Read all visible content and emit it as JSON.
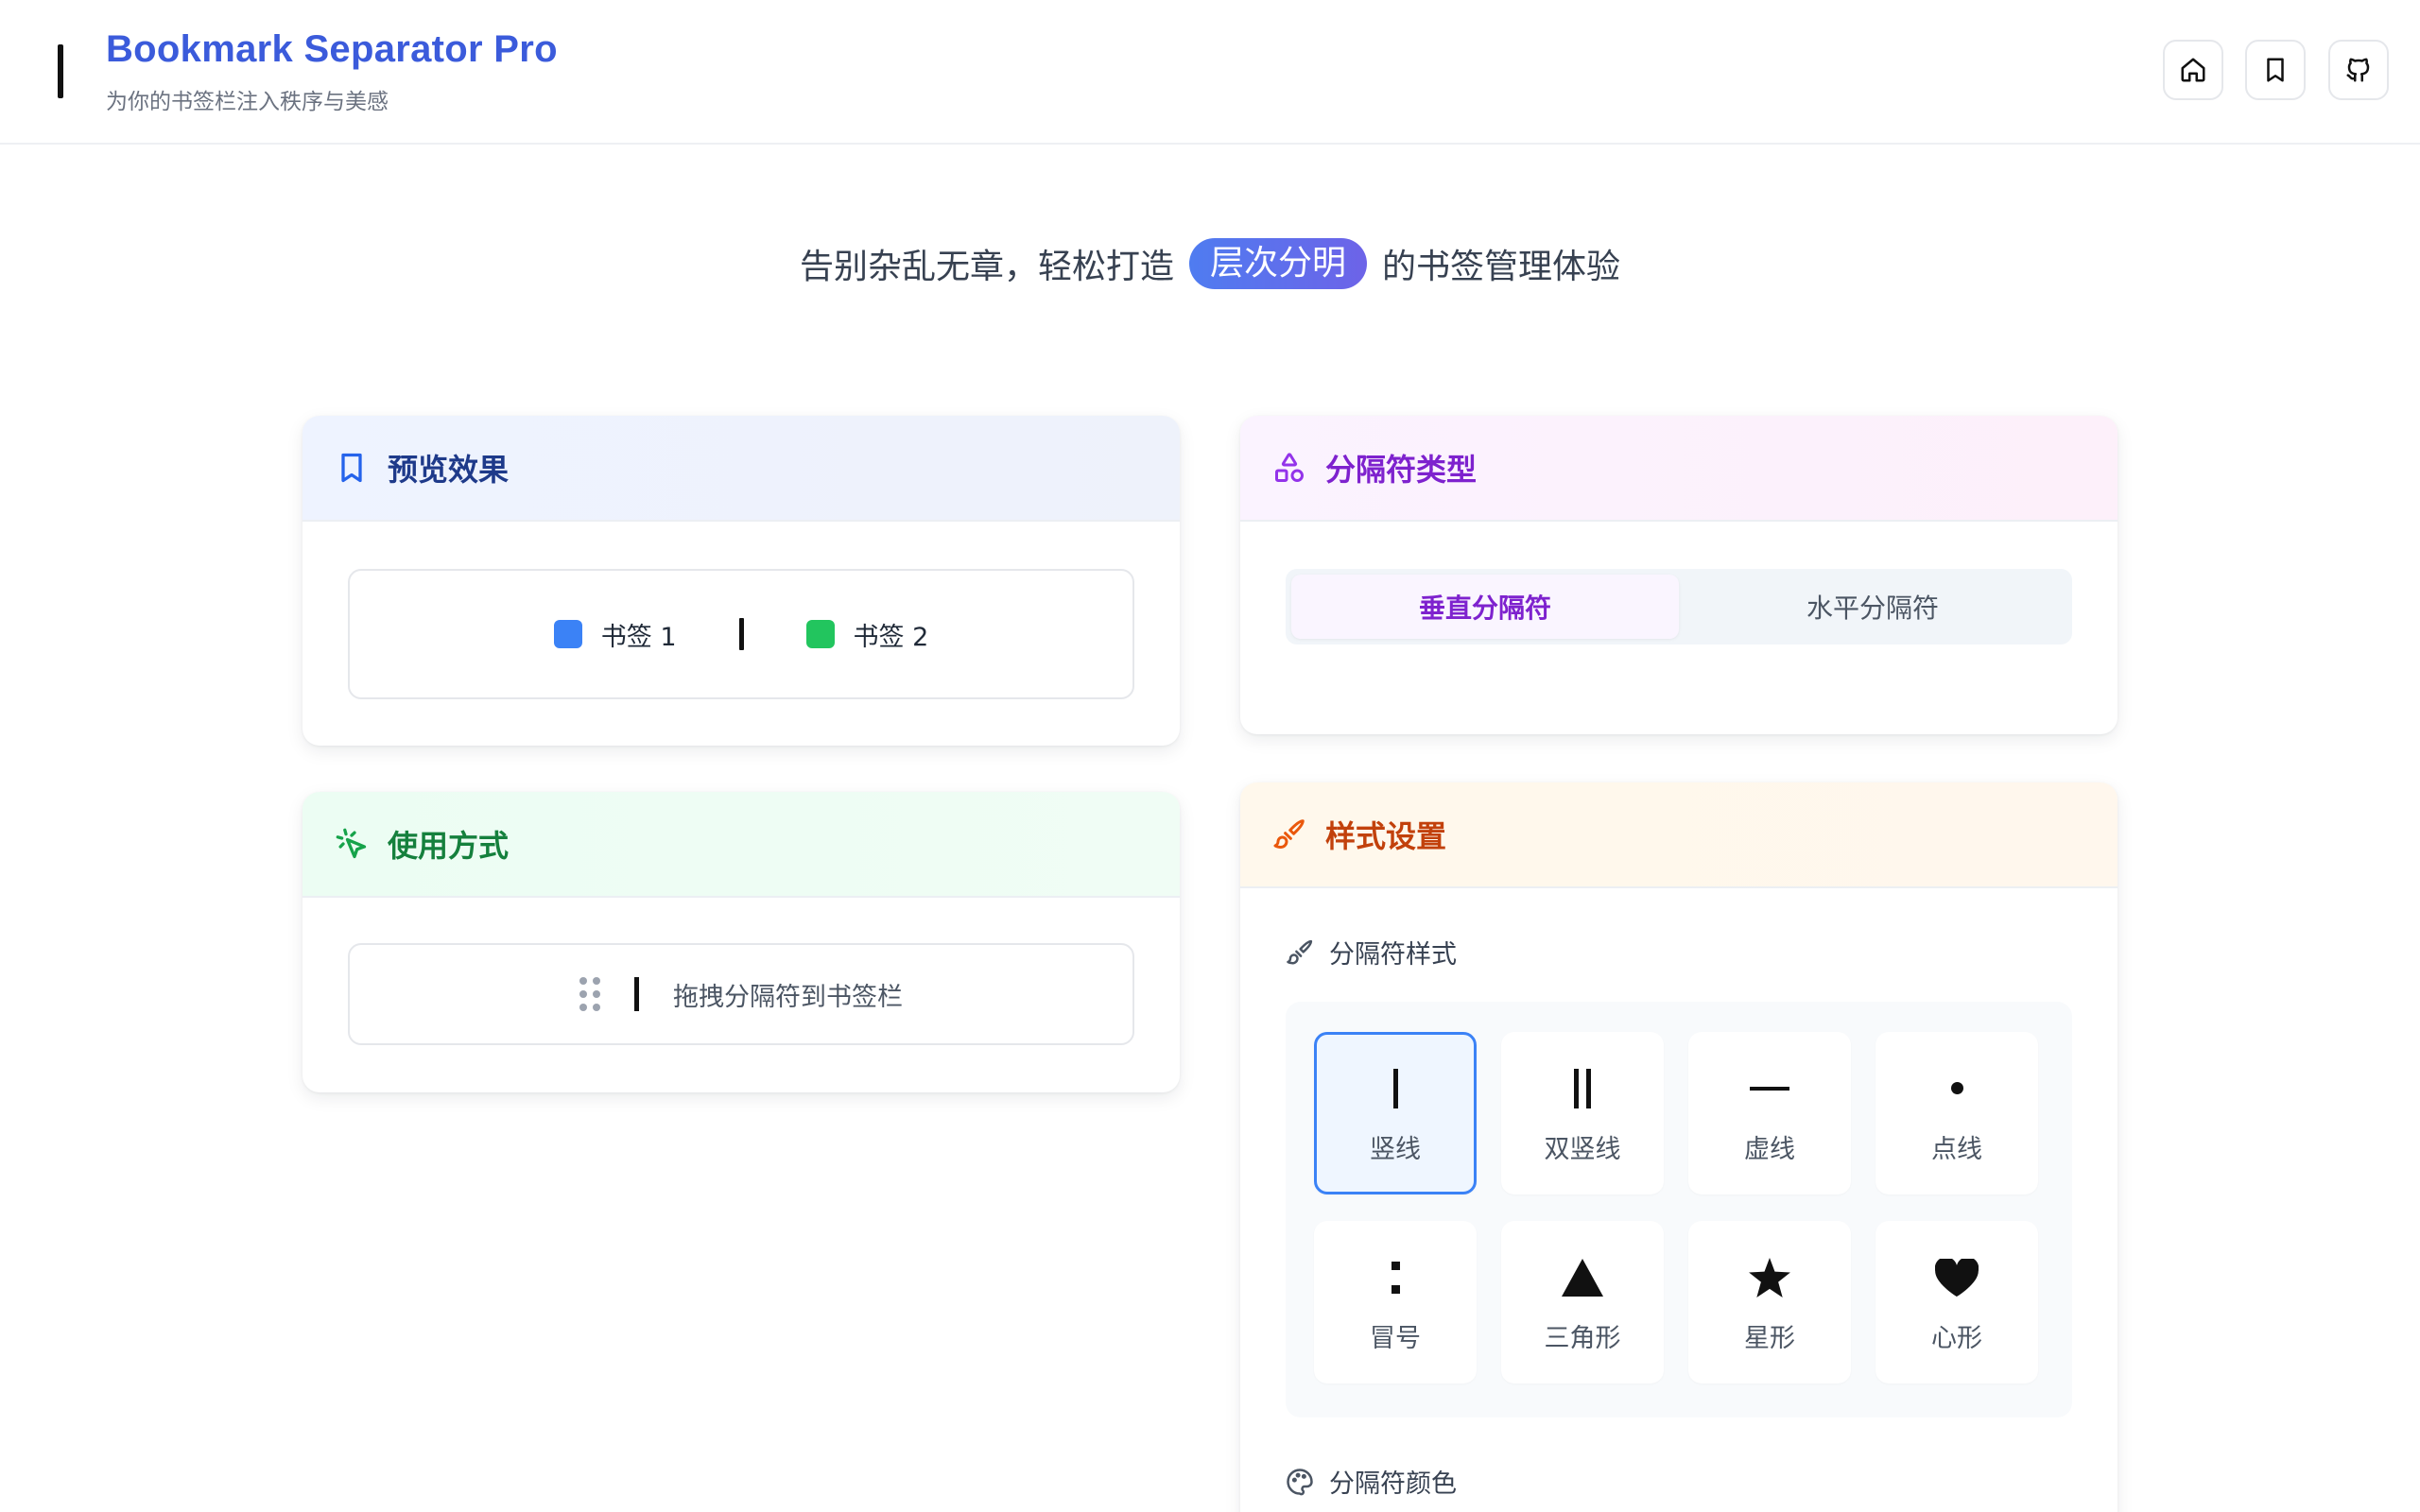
{
  "header": {
    "title": "Bookmark Separator Pro",
    "subtitle": "为你的书签栏注入秩序与美感"
  },
  "tagline": {
    "before": "告别杂乱无章，轻松打造",
    "highlight": "层次分明",
    "after": "的书签管理体验"
  },
  "preview": {
    "title": "预览效果",
    "bookmarks": [
      {
        "label": "书签 1",
        "color": "#3b82f6"
      },
      {
        "label": "书签 2",
        "color": "#22c55e"
      }
    ]
  },
  "usage": {
    "title": "使用方式",
    "instruction": "拖拽分隔符到书签栏"
  },
  "separator_type": {
    "title": "分隔符类型",
    "options": [
      "垂直分隔符",
      "水平分隔符"
    ],
    "selected": "垂直分隔符"
  },
  "style_settings": {
    "title": "样式设置",
    "style_label": "分隔符样式",
    "color_label": "分隔符颜色",
    "styles": [
      {
        "label": "竖线",
        "symbol": "|"
      },
      {
        "label": "双竖线",
        "symbol": "||"
      },
      {
        "label": "虚线",
        "symbol": "—"
      },
      {
        "label": "点线",
        "symbol": "•"
      },
      {
        "label": "冒号",
        "symbol": ":"
      },
      {
        "label": "三角形",
        "symbol": "▲"
      },
      {
        "label": "星形",
        "symbol": "★"
      },
      {
        "label": "心形",
        "symbol": "❤"
      }
    ],
    "selected_style": "竖线"
  },
  "icons": {
    "header_buttons": [
      "home-icon",
      "bookmark-icon",
      "github-icon"
    ]
  }
}
